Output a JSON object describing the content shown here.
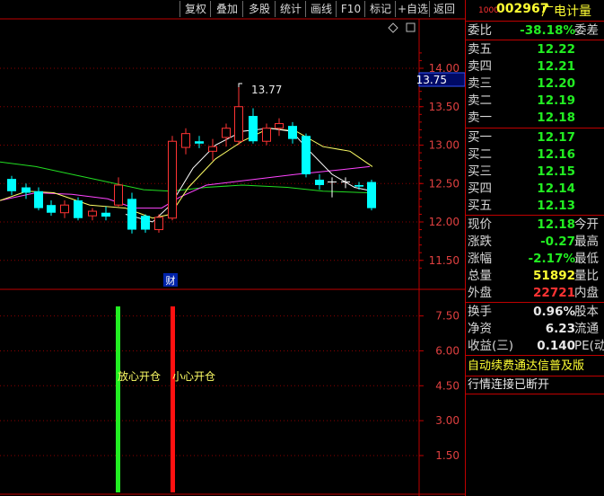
{
  "toolbar": {
    "buttons": [
      "复权",
      "叠加",
      "多股",
      "统计",
      "画线",
      "F10",
      "标记",
      "+自选",
      "返回"
    ]
  },
  "main_chart": {
    "price_axis_labels": [
      "14.00",
      "13.50",
      "13.00",
      "12.50",
      "12.00",
      "11.50"
    ],
    "current_price_tag": "13.75",
    "high_marker": "13.77",
    "finance_marker": "财"
  },
  "sub_chart": {
    "axis_labels": [
      "7.50",
      "6.00",
      "4.50",
      "3.00",
      "1.50"
    ],
    "signal_buy_label": "放心开仓",
    "signal_sell_label": "小心开仓"
  },
  "quote": {
    "code": "002967",
    "name": "广电计量",
    "code_prefix": "1000",
    "webi_label": "委比",
    "webi_value": "-38.18%",
    "wecha_label": "委差",
    "sell": [
      {
        "label": "卖五",
        "price": "12.22"
      },
      {
        "label": "卖四",
        "price": "12.21"
      },
      {
        "label": "卖三",
        "price": "12.20"
      },
      {
        "label": "卖二",
        "price": "12.19"
      },
      {
        "label": "卖一",
        "price": "12.18"
      }
    ],
    "buy": [
      {
        "label": "买一",
        "price": "12.17"
      },
      {
        "label": "买二",
        "price": "12.16"
      },
      {
        "label": "买三",
        "price": "12.15"
      },
      {
        "label": "买四",
        "price": "12.14"
      },
      {
        "label": "买五",
        "price": "12.13"
      }
    ],
    "stats": [
      {
        "label": "现价",
        "value": "12.18",
        "label2": "今开",
        "color": "green"
      },
      {
        "label": "涨跌",
        "value": "-0.27",
        "label2": "最高",
        "color": "green"
      },
      {
        "label": "涨幅",
        "value": "-2.17%",
        "label2": "最低",
        "color": "green"
      },
      {
        "label": "总量",
        "value": "51892",
        "label2": "量比",
        "color": "yellow"
      },
      {
        "label": "外盘",
        "value": "22721",
        "label2": "内盘",
        "color": "red"
      }
    ],
    "finance": [
      {
        "label": "换手",
        "value": "0.96%",
        "label2": "股本"
      },
      {
        "label": "净资",
        "value": "6.23",
        "label2": "流通"
      },
      {
        "label": "收益(三)",
        "value": "0.140",
        "label2": "PE(动"
      }
    ],
    "notice1": "自动续费通达信普及版",
    "notice2": "行情连接已断开"
  },
  "colors": {
    "up": "#ff3333",
    "down": "#00ffff",
    "ma_white": "#ffffff",
    "ma_yellow": "#ffff66",
    "ma_magenta": "#ff44ff",
    "ma_green": "#22dd22",
    "grid": "#8b0000"
  }
}
